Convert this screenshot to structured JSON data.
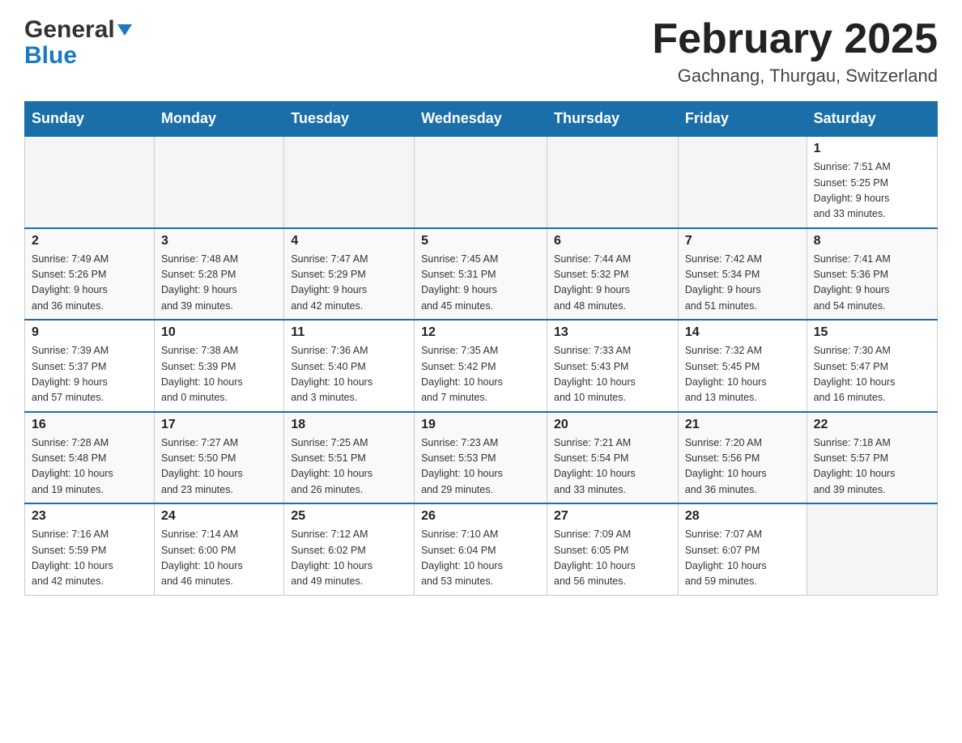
{
  "header": {
    "logo_general": "General",
    "logo_blue": "Blue",
    "month_title": "February 2025",
    "location": "Gachnang, Thurgau, Switzerland"
  },
  "days_of_week": [
    "Sunday",
    "Monday",
    "Tuesday",
    "Wednesday",
    "Thursday",
    "Friday",
    "Saturday"
  ],
  "weeks": [
    {
      "days": [
        {
          "num": "",
          "info": ""
        },
        {
          "num": "",
          "info": ""
        },
        {
          "num": "",
          "info": ""
        },
        {
          "num": "",
          "info": ""
        },
        {
          "num": "",
          "info": ""
        },
        {
          "num": "",
          "info": ""
        },
        {
          "num": "1",
          "info": "Sunrise: 7:51 AM\nSunset: 5:25 PM\nDaylight: 9 hours\nand 33 minutes."
        }
      ]
    },
    {
      "days": [
        {
          "num": "2",
          "info": "Sunrise: 7:49 AM\nSunset: 5:26 PM\nDaylight: 9 hours\nand 36 minutes."
        },
        {
          "num": "3",
          "info": "Sunrise: 7:48 AM\nSunset: 5:28 PM\nDaylight: 9 hours\nand 39 minutes."
        },
        {
          "num": "4",
          "info": "Sunrise: 7:47 AM\nSunset: 5:29 PM\nDaylight: 9 hours\nand 42 minutes."
        },
        {
          "num": "5",
          "info": "Sunrise: 7:45 AM\nSunset: 5:31 PM\nDaylight: 9 hours\nand 45 minutes."
        },
        {
          "num": "6",
          "info": "Sunrise: 7:44 AM\nSunset: 5:32 PM\nDaylight: 9 hours\nand 48 minutes."
        },
        {
          "num": "7",
          "info": "Sunrise: 7:42 AM\nSunset: 5:34 PM\nDaylight: 9 hours\nand 51 minutes."
        },
        {
          "num": "8",
          "info": "Sunrise: 7:41 AM\nSunset: 5:36 PM\nDaylight: 9 hours\nand 54 minutes."
        }
      ]
    },
    {
      "days": [
        {
          "num": "9",
          "info": "Sunrise: 7:39 AM\nSunset: 5:37 PM\nDaylight: 9 hours\nand 57 minutes."
        },
        {
          "num": "10",
          "info": "Sunrise: 7:38 AM\nSunset: 5:39 PM\nDaylight: 10 hours\nand 0 minutes."
        },
        {
          "num": "11",
          "info": "Sunrise: 7:36 AM\nSunset: 5:40 PM\nDaylight: 10 hours\nand 3 minutes."
        },
        {
          "num": "12",
          "info": "Sunrise: 7:35 AM\nSunset: 5:42 PM\nDaylight: 10 hours\nand 7 minutes."
        },
        {
          "num": "13",
          "info": "Sunrise: 7:33 AM\nSunset: 5:43 PM\nDaylight: 10 hours\nand 10 minutes."
        },
        {
          "num": "14",
          "info": "Sunrise: 7:32 AM\nSunset: 5:45 PM\nDaylight: 10 hours\nand 13 minutes."
        },
        {
          "num": "15",
          "info": "Sunrise: 7:30 AM\nSunset: 5:47 PM\nDaylight: 10 hours\nand 16 minutes."
        }
      ]
    },
    {
      "days": [
        {
          "num": "16",
          "info": "Sunrise: 7:28 AM\nSunset: 5:48 PM\nDaylight: 10 hours\nand 19 minutes."
        },
        {
          "num": "17",
          "info": "Sunrise: 7:27 AM\nSunset: 5:50 PM\nDaylight: 10 hours\nand 23 minutes."
        },
        {
          "num": "18",
          "info": "Sunrise: 7:25 AM\nSunset: 5:51 PM\nDaylight: 10 hours\nand 26 minutes."
        },
        {
          "num": "19",
          "info": "Sunrise: 7:23 AM\nSunset: 5:53 PM\nDaylight: 10 hours\nand 29 minutes."
        },
        {
          "num": "20",
          "info": "Sunrise: 7:21 AM\nSunset: 5:54 PM\nDaylight: 10 hours\nand 33 minutes."
        },
        {
          "num": "21",
          "info": "Sunrise: 7:20 AM\nSunset: 5:56 PM\nDaylight: 10 hours\nand 36 minutes."
        },
        {
          "num": "22",
          "info": "Sunrise: 7:18 AM\nSunset: 5:57 PM\nDaylight: 10 hours\nand 39 minutes."
        }
      ]
    },
    {
      "days": [
        {
          "num": "23",
          "info": "Sunrise: 7:16 AM\nSunset: 5:59 PM\nDaylight: 10 hours\nand 42 minutes."
        },
        {
          "num": "24",
          "info": "Sunrise: 7:14 AM\nSunset: 6:00 PM\nDaylight: 10 hours\nand 46 minutes."
        },
        {
          "num": "25",
          "info": "Sunrise: 7:12 AM\nSunset: 6:02 PM\nDaylight: 10 hours\nand 49 minutes."
        },
        {
          "num": "26",
          "info": "Sunrise: 7:10 AM\nSunset: 6:04 PM\nDaylight: 10 hours\nand 53 minutes."
        },
        {
          "num": "27",
          "info": "Sunrise: 7:09 AM\nSunset: 6:05 PM\nDaylight: 10 hours\nand 56 minutes."
        },
        {
          "num": "28",
          "info": "Sunrise: 7:07 AM\nSunset: 6:07 PM\nDaylight: 10 hours\nand 59 minutes."
        },
        {
          "num": "",
          "info": ""
        }
      ]
    }
  ]
}
